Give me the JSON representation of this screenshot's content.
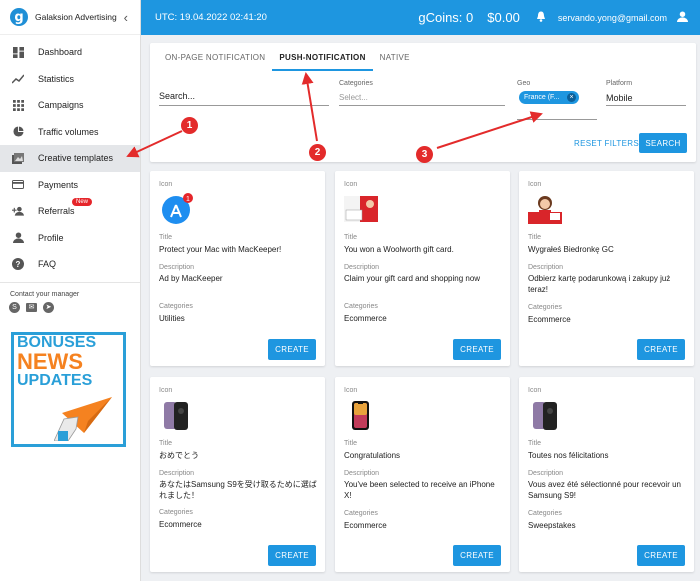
{
  "app": {
    "name": "Galaksion Advertising"
  },
  "sidebar": {
    "items": [
      {
        "label": "Dashboard",
        "icon": "dashboard-icon"
      },
      {
        "label": "Statistics",
        "icon": "statistics-icon"
      },
      {
        "label": "Campaigns",
        "icon": "campaigns-icon"
      },
      {
        "label": "Traffic volumes",
        "icon": "traffic-volumes-icon"
      },
      {
        "label": "Creative templates",
        "icon": "creative-templates-icon",
        "active": true
      },
      {
        "label": "Payments",
        "icon": "payments-icon"
      },
      {
        "label": "Referrals",
        "icon": "referrals-icon",
        "badge": "New"
      },
      {
        "label": "Profile",
        "icon": "profile-icon"
      },
      {
        "label": "FAQ",
        "icon": "faq-icon"
      }
    ],
    "contact_label": "Contact your manager",
    "banner": {
      "line1": "BONUSES",
      "line2": "NEWS",
      "line3": "UPDATES"
    }
  },
  "topbar": {
    "utc": "UTC: 19.04.2022 02:41:20",
    "gcoins": "gCoins: 0",
    "balance": "$0.00",
    "email": "servando.yong@gmail.com"
  },
  "tabs": [
    "ON-PAGE NOTIFICATION",
    "PUSH-NOTIFICATION",
    "NATIVE"
  ],
  "filters": {
    "search_placeholder": "Search...",
    "categories_label": "Categories",
    "categories_placeholder": "Select...",
    "geo_label": "Geo",
    "geo_chip": "France (F...",
    "platform_label": "Platform",
    "platform_value": "Mobile",
    "reset_label": "RESET FILTERS",
    "search_label": "SEARCH"
  },
  "card_labels": {
    "icon": "Icon",
    "title": "Title",
    "description": "Description",
    "categories": "Categories",
    "create": "CREATE"
  },
  "cards": [
    {
      "title": "Protect your Mac with MacKeeper!",
      "description": "Ad by MacKeeper",
      "category": "Utilities",
      "icon": "app-store-icon"
    },
    {
      "title": "You won a Woolworth gift card.",
      "description": "Claim your gift card and shopping now",
      "category": "Ecommerce",
      "icon": "gift-card-icon"
    },
    {
      "title": "Wygrałeś Biedronkę GC",
      "description": "Odbierz kartę podarunkową i zakupy już teraz!",
      "category": "Ecommerce",
      "icon": "gift-card-woman-icon"
    },
    {
      "title": "おめでとう",
      "description": "あなたはSamsung S9を受け取るために選ばれました！",
      "category": "Ecommerce",
      "icon": "samsung-phone-icon"
    },
    {
      "title": "Congratulations",
      "description": "You've been selected to receive an iPhone X!",
      "category": "Ecommerce",
      "icon": "iphone-icon"
    },
    {
      "title": "Toutes nos félicitations",
      "description": "Vous avez été sélectionné pour recevoir un Samsung S9!",
      "category": "Sweepstakes",
      "icon": "samsung-phone-icon"
    }
  ],
  "annotations": [
    "1",
    "2",
    "3"
  ],
  "colors": {
    "accent": "#1e96e0",
    "annotation": "#e32b2b"
  }
}
